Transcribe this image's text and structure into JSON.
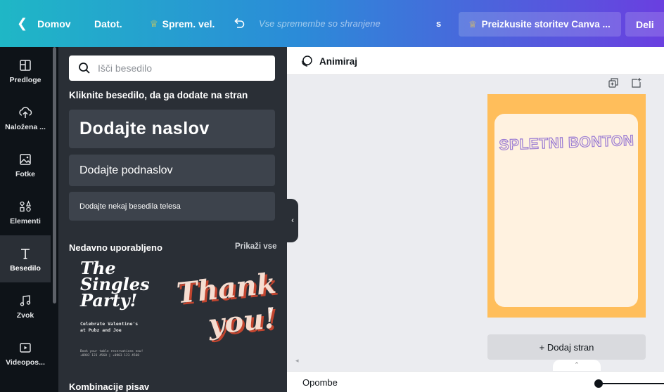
{
  "topbar": {
    "home": "Domov",
    "file": "Datot.",
    "resize": "Sprem. vel.",
    "saved": "Vse spremembe so shranjene",
    "s_letter": "s",
    "try_pro": "Preizkusite storitev Canva ...",
    "share": "Deli"
  },
  "rail": [
    {
      "label": "Predloge",
      "icon": "templates-icon"
    },
    {
      "label": "Naložena ...",
      "icon": "upload-cloud-icon"
    },
    {
      "label": "Fotke",
      "icon": "photos-icon"
    },
    {
      "label": "Elementi",
      "icon": "elements-icon"
    },
    {
      "label": "Besedilo",
      "icon": "text-icon"
    },
    {
      "label": "Zvok",
      "icon": "music-icon"
    },
    {
      "label": "Videopos...",
      "icon": "video-icon"
    }
  ],
  "panel": {
    "search_placeholder": "Išči besedilo",
    "hint": "Kliknite besedilo, da ga dodate na stran",
    "add_heading": "Dodajte naslov",
    "add_subheading": "Dodajte podnaslov",
    "add_body": "Dodajte nekaj besedila telesa",
    "recent_title": "Nedavno uporabljeno",
    "show_all": "Prikaži vse",
    "card1": {
      "line1": "The",
      "line2": "Singles",
      "line3": "Party!",
      "sub1": "Celebrate Valentine's",
      "sub2": "at Pubz and Joe",
      "small1": "Book your table reservations now!",
      "small2": "+0982 123 4568 | +0983 123 4568"
    },
    "card2": {
      "line1": "Thank",
      "line2": "you!"
    },
    "combos_title": "Kombinacije pisav"
  },
  "editor": {
    "animate": "Animiraj",
    "page_title": "SPLETNI BONTON",
    "add_page": "+ Dodaj stran",
    "notes": "Opombe"
  },
  "colors": {
    "page_bg": "#ffbe5b",
    "page_inner": "#fff2e0",
    "title_outline": "#9a7bd3",
    "panel_bg": "#2a2f36",
    "rail_bg": "#0e1318"
  }
}
